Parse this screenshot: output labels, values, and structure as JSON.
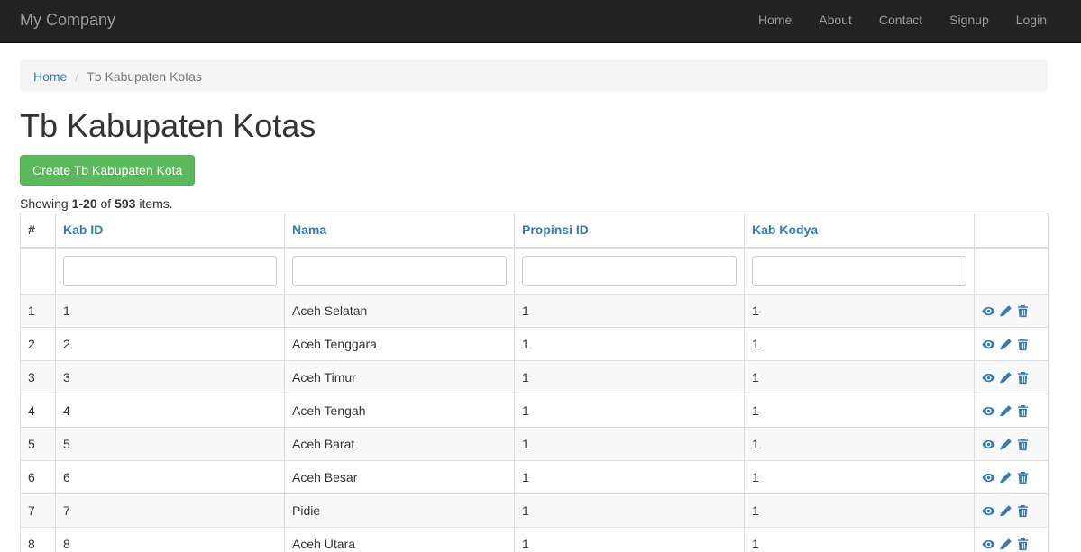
{
  "navbar": {
    "brand": "My Company",
    "items": [
      "Home",
      "About",
      "Contact",
      "Signup",
      "Login"
    ]
  },
  "breadcrumb": {
    "home": "Home",
    "separator": "/",
    "current": "Tb Kabupaten Kotas"
  },
  "page": {
    "title": "Tb Kabupaten Kotas",
    "create_button": "Create Tb Kabupaten Kota"
  },
  "summary": {
    "prefix": "Showing",
    "range": "1-20",
    "of": "of",
    "total": "593",
    "suffix": "items."
  },
  "table": {
    "headers": [
      "#",
      "Kab ID",
      "Nama",
      "Propinsi ID",
      "Kab Kodya",
      ""
    ],
    "rows": [
      [
        "1",
        "1",
        "Aceh Selatan",
        "1",
        "1"
      ],
      [
        "2",
        "2",
        "Aceh Tenggara",
        "1",
        "1"
      ],
      [
        "3",
        "3",
        "Aceh Timur",
        "1",
        "1"
      ],
      [
        "4",
        "4",
        "Aceh Tengah",
        "1",
        "1"
      ],
      [
        "5",
        "5",
        "Aceh Barat",
        "1",
        "1"
      ],
      [
        "6",
        "6",
        "Aceh Besar",
        "1",
        "1"
      ],
      [
        "7",
        "7",
        "Pidie",
        "1",
        "1"
      ],
      [
        "8",
        "8",
        "Aceh Utara",
        "1",
        "1"
      ]
    ],
    "action_icons": [
      "eye-icon",
      "pencil-icon",
      "trash-icon"
    ]
  },
  "colors": {
    "navbar_bg": "#222222",
    "nav_text": "#9d9d9d",
    "link": "#337ab7",
    "success": "#5cb85c",
    "stripe": "#f9f9f9"
  }
}
